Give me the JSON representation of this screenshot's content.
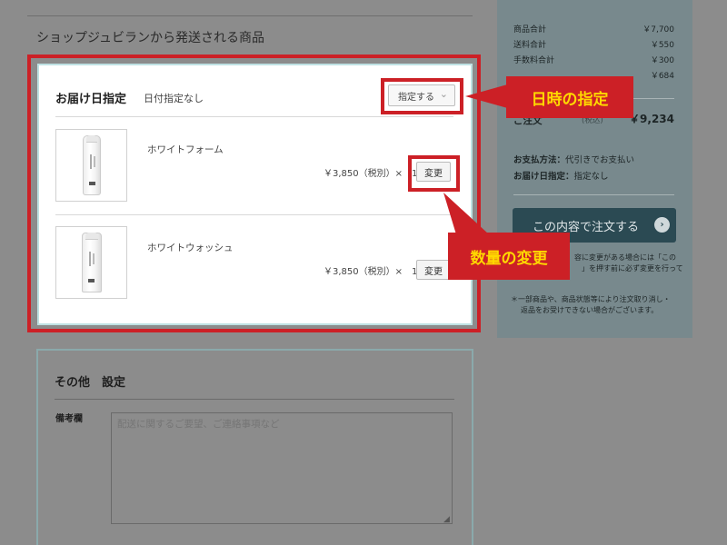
{
  "shop_section": {
    "title": "ショップジュビランから発送される商品"
  },
  "delivery": {
    "title": "お届け日指定",
    "value": "日付指定なし",
    "select_label": "指定する"
  },
  "products": [
    {
      "name": "ホワイトフォーム",
      "price": "￥3,850（税別）×　1",
      "change_label": "変更"
    },
    {
      "name": "ホワイトウォッシュ",
      "price": "￥3,850（税別）×　1",
      "change_label": "変更"
    }
  ],
  "other": {
    "title": "その他　設定",
    "remarks_label": "備考欄",
    "remarks_placeholder": "配送に関するご要望、ご連絡事項など"
  },
  "summary": {
    "rows": [
      {
        "label": "商品合計",
        "value": "￥7,700"
      },
      {
        "label": "送料合計",
        "value": "￥550"
      },
      {
        "label": "手数料合計",
        "value": "￥300"
      },
      {
        "label": "",
        "value": "￥684"
      }
    ],
    "total_label": "ご注文",
    "total_tax": "(税込)",
    "total_value": "￥9,234",
    "payment_label": "お支払方法：",
    "payment_value": "代引きでお支払い",
    "delivery_label": "お届け日指定：",
    "delivery_value": "指定なし",
    "order_button": "この内容で注文する",
    "change_note_1": "容に変更がある場合には「この",
    "change_note_2": "」を押す前に必ず変更を行って",
    "footnote_1": "＊一部商品や、商品状態等により注文取り消し・",
    "footnote_2": "返品をお受けできない場合がございます。"
  },
  "callouts": {
    "date": "日時の指定",
    "quantity": "数量の変更"
  },
  "colors": {
    "overlay_gray": "#8c8c8c",
    "highlight_red": "#cc2026",
    "callout_text": "#ffd800",
    "card_border": "#bfe2e3",
    "summary_bg": "#78898d",
    "order_button_bg": "#2b4a53"
  }
}
